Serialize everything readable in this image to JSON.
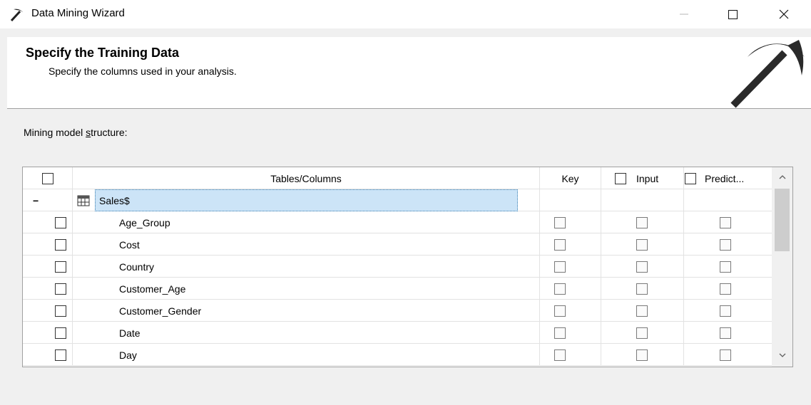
{
  "window": {
    "title": "Data Mining Wizard",
    "controls": {
      "minimize": "minimize",
      "maximize": "maximize",
      "close": "close"
    }
  },
  "header": {
    "title": "Specify the Training Data",
    "subtitle": "Specify the columns used in your analysis."
  },
  "section": {
    "label_prefix": "Mining model ",
    "label_underlined": "s",
    "label_suffix": "tructure:"
  },
  "grid": {
    "columns": {
      "tables_columns": "Tables/Columns",
      "key": "Key",
      "input": "Input",
      "predict": "Predict..."
    },
    "table": {
      "expander": "−",
      "name": "Sales$",
      "icon": "table-icon"
    },
    "rows": [
      {
        "name": "Age_Group"
      },
      {
        "name": "Cost"
      },
      {
        "name": "Country"
      },
      {
        "name": "Customer_Age"
      },
      {
        "name": "Customer_Gender"
      },
      {
        "name": "Date"
      },
      {
        "name": "Day"
      }
    ]
  }
}
